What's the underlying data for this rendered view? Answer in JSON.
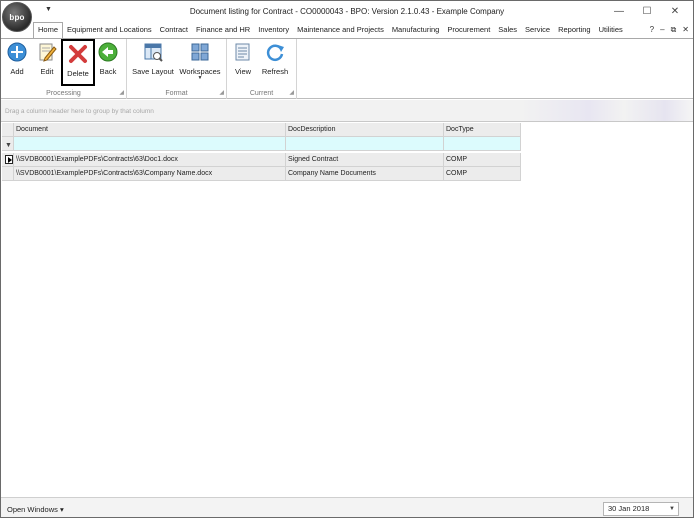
{
  "app": {
    "logo_text": "bpo",
    "window_title": "Document listing for Contract - CO0000043 - BPO: Version 2.1.0.43 - Example Company",
    "controls": {
      "minimize": "—",
      "maximize": "☐",
      "close": "✕"
    },
    "mdi_controls": {
      "help": "?",
      "minimize": "–",
      "restore": "⧉",
      "close": "✕"
    }
  },
  "ribbon": {
    "tabs": [
      {
        "label": "Home",
        "active": true
      },
      {
        "label": "Equipment and Locations"
      },
      {
        "label": "Contract"
      },
      {
        "label": "Finance and HR"
      },
      {
        "label": "Inventory"
      },
      {
        "label": "Maintenance and Projects"
      },
      {
        "label": "Manufacturing"
      },
      {
        "label": "Procurement"
      },
      {
        "label": "Sales"
      },
      {
        "label": "Service"
      },
      {
        "label": "Reporting"
      },
      {
        "label": "Utilities"
      }
    ],
    "groups": {
      "processing": {
        "label": "Processing",
        "add": "Add",
        "edit": "Edit",
        "delete": "Delete",
        "back": "Back"
      },
      "format": {
        "label": "Format",
        "save_layout": "Save Layout",
        "workspaces": "Workspaces"
      },
      "current": {
        "label": "Current",
        "view": "View",
        "refresh": "Refresh"
      }
    }
  },
  "groupby": {
    "hint": "Drag a column header here to group by that column"
  },
  "grid": {
    "columns": [
      "Document",
      "DocDescription",
      "DocType"
    ],
    "rows": [
      {
        "document": "\\\\SVDB0001\\ExamplePDFs\\Contracts\\63\\Doc1.docx",
        "description": "Signed Contract",
        "type": "COMP"
      },
      {
        "document": "\\\\SVDB0001\\ExamplePDFs\\Contracts\\63\\Company Name.docx",
        "description": "Company Name Documents",
        "type": "COMP"
      }
    ]
  },
  "status": {
    "open_windows": "Open Windows ▾",
    "date": "30 Jan 2018"
  }
}
